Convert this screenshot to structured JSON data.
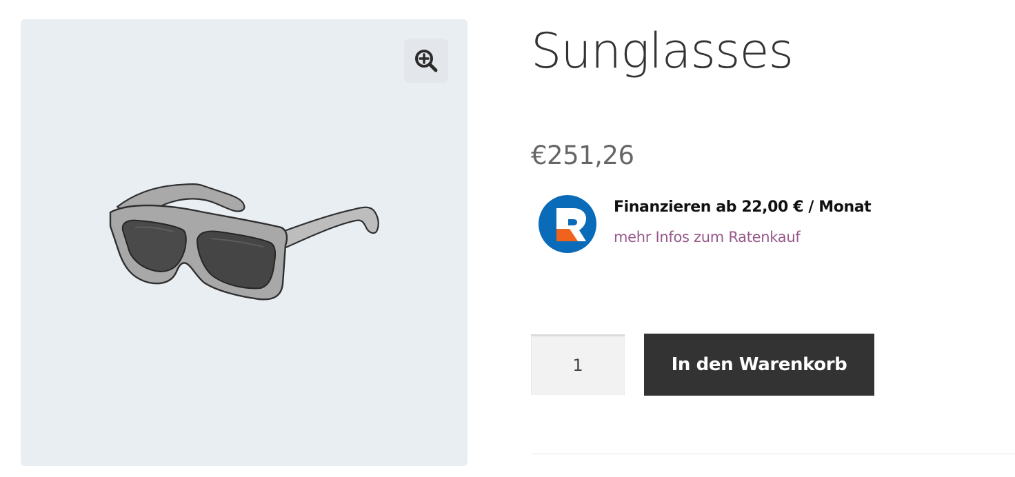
{
  "product": {
    "title": "Sunglasses",
    "price": "€251,26",
    "image_icon": "sunglasses-product-image"
  },
  "gallery": {
    "zoom_icon": "zoom-in-icon",
    "background_color": "#e9eef3"
  },
  "financing": {
    "logo_icon": "ratenkauf-logo",
    "headline": "Finanzieren ab 22,00 € / Monat",
    "link_text": "mehr Infos zum Ratenkauf",
    "link_color": "#96588a",
    "logo_colors": {
      "blue": "#0a6bb8",
      "orange": "#f0631c"
    }
  },
  "cart": {
    "quantity": "1",
    "add_to_cart_label": "In den Warenkorb",
    "button_color": "#333333"
  }
}
